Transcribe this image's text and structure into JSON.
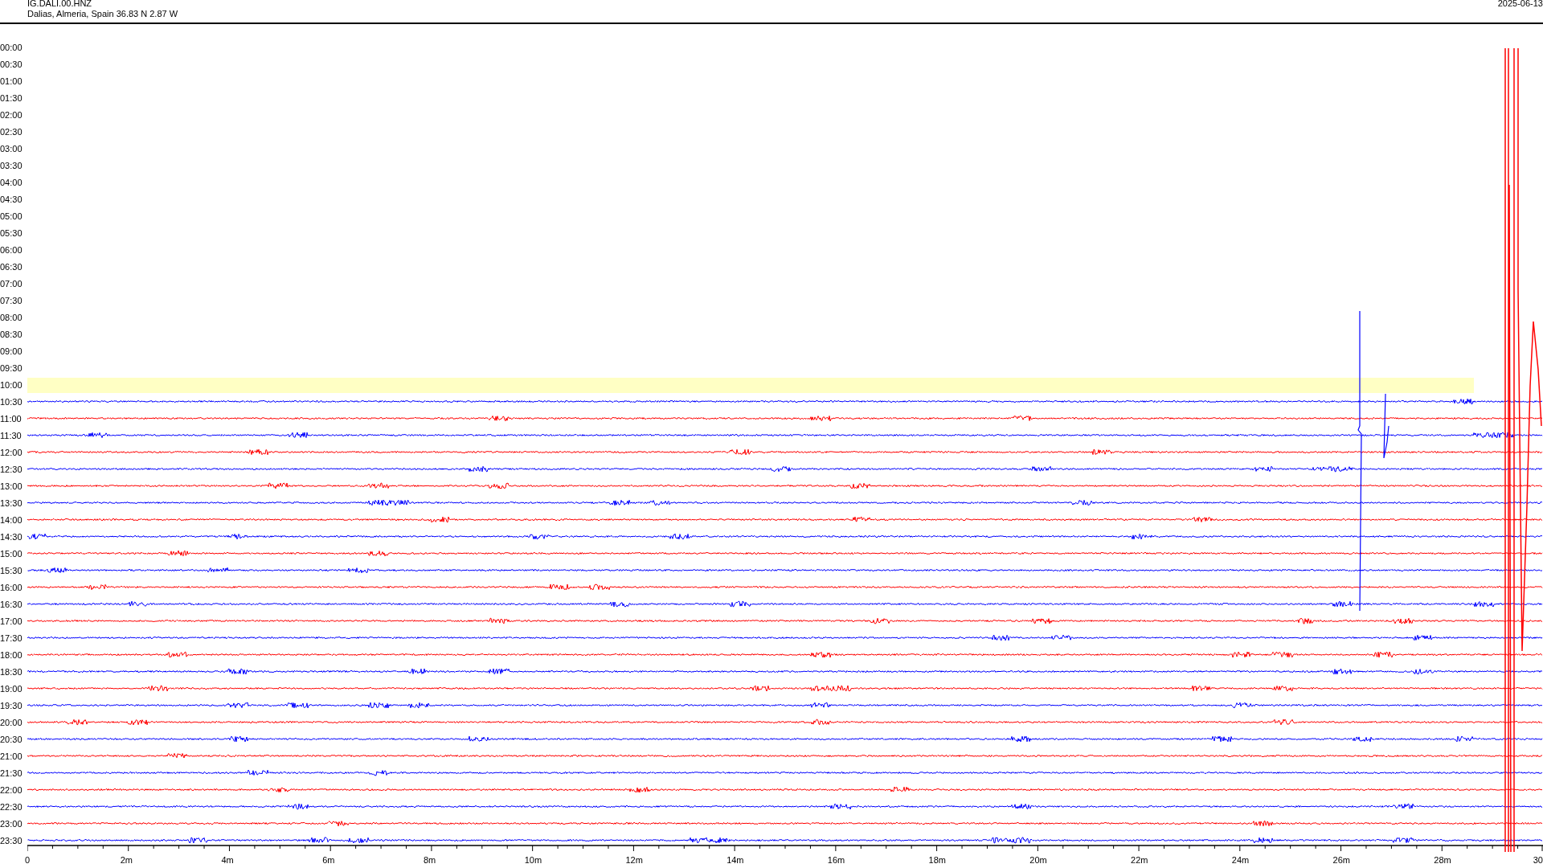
{
  "header": {
    "station": "IG.DALI.00.HNZ",
    "location": "Dalias, Almeria, Spain  36.83 N 2.87 W",
    "date": "2025-06-13"
  },
  "rows": [
    {
      "time": "00:00",
      "highlighted": false
    },
    {
      "time": "00:30",
      "highlighted": false
    },
    {
      "time": "01:00",
      "highlighted": false
    },
    {
      "time": "01:30",
      "highlighted": false
    },
    {
      "time": "02:00",
      "highlighted": false
    },
    {
      "time": "02:30",
      "highlighted": false
    },
    {
      "time": "03:00",
      "highlighted": false
    },
    {
      "time": "03:30",
      "highlighted": false
    },
    {
      "time": "04:00",
      "highlighted": false
    },
    {
      "time": "04:30",
      "highlighted": false
    },
    {
      "time": "05:00",
      "highlighted": false
    },
    {
      "time": "05:30",
      "highlighted": false
    },
    {
      "time": "06:00",
      "highlighted": false
    },
    {
      "time": "06:30",
      "highlighted": false
    },
    {
      "time": "07:00",
      "highlighted": false
    },
    {
      "time": "07:30",
      "highlighted": false
    },
    {
      "time": "08:00",
      "highlighted": false
    },
    {
      "time": "08:30",
      "highlighted": false
    },
    {
      "time": "09:00",
      "highlighted": false
    },
    {
      "time": "09:30",
      "highlighted": false
    },
    {
      "time": "10:00",
      "highlighted": true
    },
    {
      "time": "10:30",
      "highlighted": false,
      "color": "#0000ff"
    },
    {
      "time": "11:00",
      "highlighted": false,
      "color": "#ff0000"
    },
    {
      "time": "11:30",
      "highlighted": false,
      "color": "#0000ff"
    },
    {
      "time": "12:00",
      "highlighted": false,
      "color": "#ff0000"
    },
    {
      "time": "12:30",
      "highlighted": false,
      "color": "#0000ff"
    },
    {
      "time": "13:00",
      "highlighted": false,
      "color": "#ff0000"
    },
    {
      "time": "13:30",
      "highlighted": false,
      "color": "#0000ff"
    },
    {
      "time": "14:00",
      "highlighted": false,
      "color": "#ff0000"
    },
    {
      "time": "14:30",
      "highlighted": false,
      "color": "#0000ff"
    },
    {
      "time": "15:00",
      "highlighted": false,
      "color": "#ff0000"
    },
    {
      "time": "15:30",
      "highlighted": false,
      "color": "#0000ff"
    },
    {
      "time": "16:00",
      "highlighted": false,
      "color": "#ff0000"
    },
    {
      "time": "16:30",
      "highlighted": false,
      "color": "#0000ff"
    },
    {
      "time": "17:00",
      "highlighted": false,
      "color": "#ff0000"
    },
    {
      "time": "17:30",
      "highlighted": false,
      "color": "#0000ff"
    },
    {
      "time": "18:00",
      "highlighted": false,
      "color": "#ff0000"
    },
    {
      "time": "18:30",
      "highlighted": false,
      "color": "#0000ff"
    },
    {
      "time": "19:00",
      "highlighted": false,
      "color": "#ff0000"
    },
    {
      "time": "19:30",
      "highlighted": false,
      "color": "#0000ff"
    },
    {
      "time": "20:00",
      "highlighted": false,
      "color": "#ff0000"
    },
    {
      "time": "20:30",
      "highlighted": false,
      "color": "#0000ff"
    },
    {
      "time": "21:00",
      "highlighted": false,
      "color": "#ff0000"
    },
    {
      "time": "21:30",
      "highlighted": false,
      "color": "#0000ff"
    },
    {
      "time": "22:00",
      "highlighted": false,
      "color": "#ff0000"
    },
    {
      "time": "22:30",
      "highlighted": false,
      "color": "#0000ff"
    },
    {
      "time": "23:00",
      "highlighted": false,
      "color": "#ff0000"
    },
    {
      "time": "23:30",
      "highlighted": false,
      "color": "#0000ff"
    }
  ],
  "x_axis": {
    "labels": [
      "0",
      "2m",
      "4m",
      "6m",
      "8m",
      "10m",
      "12m",
      "14m",
      "16m",
      "18m",
      "20m",
      "22m",
      "24m",
      "26m",
      "28m",
      "30"
    ]
  }
}
